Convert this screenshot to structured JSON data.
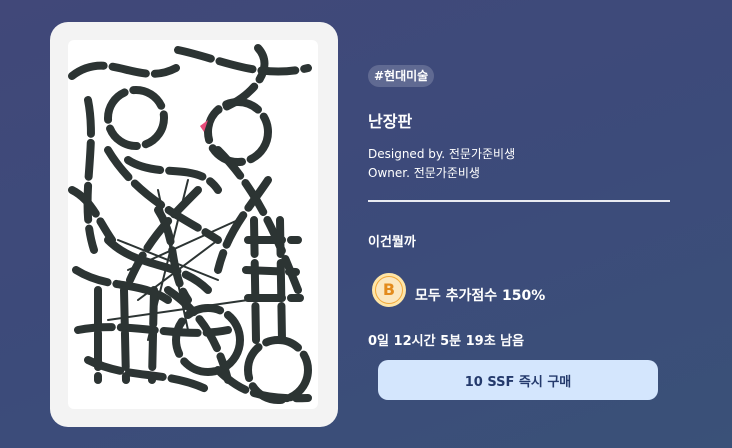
{
  "item": {
    "tag": "#현대미술",
    "title": "난장판",
    "designer": "Designed by. 전문가준비생",
    "owner": "Owner. 전문가준비생",
    "description": "이건뭘까",
    "badge_letter": "B",
    "bonus": "모두 추가점수 150%",
    "time_remaining": "0일 12시간 5분 19초 남음",
    "buy_label": "10 SSF 즉시 구매"
  },
  "colors": {
    "stroke": "#2c3433",
    "accent": "#e84b7a",
    "badge": "#f2a93b",
    "button": "#d4e6fd"
  }
}
